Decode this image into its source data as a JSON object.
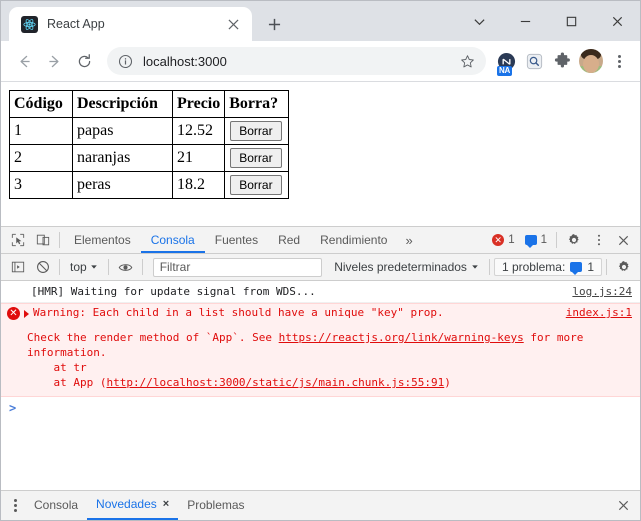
{
  "browser": {
    "tab": {
      "title": "React App",
      "favicon": "react-icon",
      "close_label": "×"
    },
    "new_tab_label": "+",
    "window_controls": {
      "tab_search": "tab-search-icon",
      "minimize": "minimize-icon",
      "maximize": "maximize-icon",
      "close": "close-icon"
    },
    "nav": {
      "back": "back-icon",
      "forward": "forward-icon",
      "reload": "reload-icon"
    },
    "omnibox": {
      "security_icon": "info-circle-icon",
      "url": "localhost:3000",
      "star": "bookmark-star-icon"
    },
    "extensions": [
      {
        "name": "nordpass-extension-icon",
        "badge": "NA"
      },
      {
        "name": "magnifier-extension-icon",
        "badge": ""
      },
      {
        "name": "puzzle-extensions-icon",
        "badge": ""
      }
    ],
    "profile": "avatar",
    "menu": "chrome-menu-icon"
  },
  "page": {
    "table": {
      "headers": [
        "Código",
        "Descripción",
        "Precio",
        "Borra?"
      ],
      "rows": [
        {
          "codigo": "1",
          "descripcion": "papas",
          "precio": "12.52",
          "action": "Borrar"
        },
        {
          "codigo": "2",
          "descripcion": "naranjas",
          "precio": "21",
          "action": "Borrar"
        },
        {
          "codigo": "3",
          "descripcion": "peras",
          "precio": "18.2",
          "action": "Borrar"
        }
      ]
    }
  },
  "devtools": {
    "toolbar": {
      "inspect_icon": "inspect-element-icon",
      "device_icon": "device-toolbar-icon",
      "tabs": [
        {
          "label": "Elementos",
          "active": false
        },
        {
          "label": "Consola",
          "active": true
        },
        {
          "label": "Fuentes",
          "active": false
        },
        {
          "label": "Red",
          "active": false
        },
        {
          "label": "Rendimiento",
          "active": false
        }
      ],
      "overflow": "»",
      "error_count": "1",
      "message_count": "1",
      "settings_icon": "gear-icon",
      "more_icon": "kebab-menu-icon",
      "close_icon": "close-icon"
    },
    "filterbar": {
      "execute_icon": "console-sidebar-icon",
      "clear_icon": "clear-console-icon",
      "context": "top",
      "eye_icon": "live-expression-icon",
      "filter_placeholder": "Filtrar",
      "filter_value": "",
      "levels": "Niveles predeterminados",
      "problems_label": "1 problema:",
      "problems_count": "1",
      "settings_icon": "gear-icon"
    },
    "console": {
      "rows": [
        {
          "type": "log",
          "message": "[HMR] Waiting for update signal from WDS...",
          "source": "log.js:24"
        },
        {
          "type": "error",
          "message": "Warning: Each child in a list should have a unique \"key\" prop.",
          "source": "index.js:1",
          "detail_pre": "Check the render method of `App`. See ",
          "detail_link": "https://reactjs.org/link/warning-keys",
          "detail_post": " for more\ninformation.\n    at tr\n    at App (",
          "detail_link2": "http://localhost:3000/static/js/main.chunk.js:55:91",
          "detail_end": ")"
        }
      ],
      "prompt": ">"
    },
    "drawer": {
      "menu_icon": "kebab-menu-icon",
      "tabs": [
        {
          "label": "Consola",
          "active": false,
          "closable": false
        },
        {
          "label": "Novedades",
          "active": true,
          "closable": true,
          "close": "×"
        },
        {
          "label": "Problemas",
          "active": false,
          "closable": false
        }
      ],
      "close_icon": "close-icon"
    }
  },
  "colors": {
    "accent": "#1a73e8",
    "error": "#d93025",
    "error_bg": "#fff0f0",
    "tabstrip_bg": "#dee1e6",
    "devtools_bg": "#f3f3f3"
  }
}
